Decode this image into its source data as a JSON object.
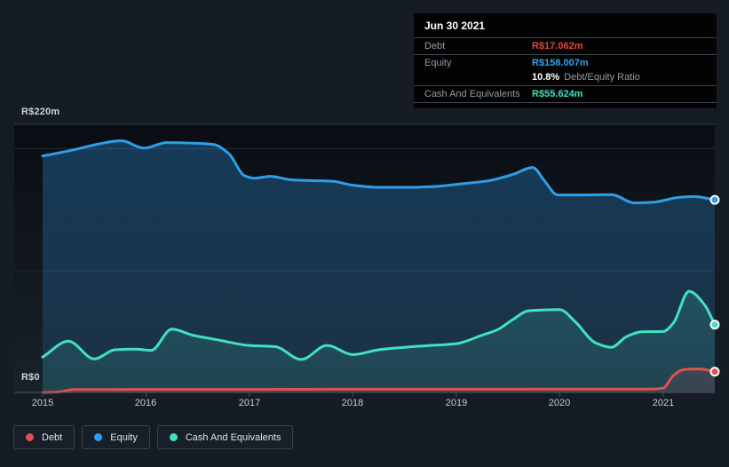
{
  "page": {
    "background": "#161c26"
  },
  "tooltip": {
    "date": "Jun 30 2021",
    "debt_label": "Debt",
    "debt_value": "R$17.062m",
    "debt_color": "#e8423e",
    "equity_label": "Equity",
    "equity_value": "R$158.007m",
    "equity_color": "#2ea4ee",
    "ratio_value": "10.8%",
    "ratio_label": "Debt/Equity Ratio",
    "cash_label": "Cash And Equivalents",
    "cash_value": "R$55.624m",
    "cash_color": "#3ce2ba"
  },
  "legend": {
    "items": [
      {
        "label": "Debt",
        "color": "#e0514e"
      },
      {
        "label": "Equity",
        "color": "#2d9fe8"
      },
      {
        "label": "Cash And Equivalents",
        "color": "#41e1bf"
      }
    ]
  },
  "chart_data": {
    "type": "area",
    "title": "Debt to Equity history",
    "currency_prefix": "R$",
    "unit_suffix": "m",
    "x_domain": [
      2015,
      2021.5
    ],
    "y_domain": [
      0,
      220
    ],
    "y_axis_labels": [
      {
        "value": 220,
        "label": "R$220m"
      },
      {
        "value": 0,
        "label": "R$0"
      }
    ],
    "x_ticks": [
      "2015",
      "2016",
      "2017",
      "2018",
      "2019",
      "2020",
      "2021"
    ],
    "x_tick_values": [
      2015,
      2016,
      2017,
      2018,
      2019,
      2020,
      2021
    ],
    "gridlines": [
      {
        "value": 220,
        "strong": true
      },
      {
        "value": 200,
        "strong": false
      },
      {
        "value": 100,
        "strong": false
      }
    ],
    "legend_position": "bottom-left",
    "series": [
      {
        "name": "Debt",
        "z": 3,
        "color": "#e0514e",
        "fill_top": "rgba(224,81,78,0.30)",
        "fill_bottom": "rgba(224,81,78,0.12)",
        "last_value": 17.062,
        "points": [
          [
            2015.0,
            0
          ],
          [
            2015.15,
            0.4
          ],
          [
            2015.3,
            2.3
          ],
          [
            2016.0,
            2.5
          ],
          [
            2017.0,
            2.5
          ],
          [
            2018.0,
            2.6
          ],
          [
            2019.0,
            2.6
          ],
          [
            2020.0,
            2.7
          ],
          [
            2020.9,
            2.8
          ],
          [
            2021.0,
            3.5
          ],
          [
            2021.1,
            14
          ],
          [
            2021.2,
            18.8
          ],
          [
            2021.35,
            19.2
          ],
          [
            2021.5,
            17.062
          ]
        ]
      },
      {
        "name": "Equity",
        "z": 1,
        "color": "#2d9fe8",
        "fill_top": "rgba(45,150,226,0.34)",
        "fill_bottom": "rgba(45,150,226,0.14)",
        "last_value": 158.007,
        "points": [
          [
            2015.0,
            194
          ],
          [
            2015.3,
            199
          ],
          [
            2015.55,
            204
          ],
          [
            2015.76,
            206.5
          ],
          [
            2015.98,
            200.5
          ],
          [
            2016.2,
            205
          ],
          [
            2016.45,
            204.5
          ],
          [
            2016.65,
            203.5
          ],
          [
            2016.8,
            196
          ],
          [
            2016.95,
            178
          ],
          [
            2017.05,
            175.8
          ],
          [
            2017.2,
            177.3
          ],
          [
            2017.4,
            174.5
          ],
          [
            2017.6,
            173.8
          ],
          [
            2017.8,
            173.3
          ],
          [
            2018.0,
            170
          ],
          [
            2018.25,
            168.3
          ],
          [
            2018.55,
            168.3
          ],
          [
            2018.8,
            169
          ],
          [
            2019.05,
            171.2
          ],
          [
            2019.3,
            173.5
          ],
          [
            2019.55,
            179
          ],
          [
            2019.74,
            184.6
          ],
          [
            2019.85,
            174
          ],
          [
            2019.98,
            162
          ],
          [
            2020.2,
            162
          ],
          [
            2020.5,
            162.3
          ],
          [
            2020.72,
            155.5
          ],
          [
            2020.9,
            156
          ],
          [
            2021.15,
            160
          ],
          [
            2021.3,
            160.7
          ],
          [
            2021.5,
            158.007
          ]
        ]
      },
      {
        "name": "Cash And Equivalents",
        "z": 2,
        "color": "#41e1bf",
        "fill_top": "rgba(72,224,193,0.28)",
        "fill_bottom": "rgba(72,224,193,0.10)",
        "last_value": 55.624,
        "points": [
          [
            2015.0,
            29
          ],
          [
            2015.25,
            42
          ],
          [
            2015.5,
            27.5
          ],
          [
            2015.7,
            35
          ],
          [
            2015.9,
            35.5
          ],
          [
            2016.05,
            34.5
          ],
          [
            2016.25,
            52
          ],
          [
            2016.45,
            47
          ],
          [
            2016.7,
            43
          ],
          [
            2017.0,
            38.5
          ],
          [
            2017.25,
            37.5
          ],
          [
            2017.5,
            27
          ],
          [
            2017.75,
            38.5
          ],
          [
            2018.0,
            31
          ],
          [
            2018.25,
            35
          ],
          [
            2018.5,
            37
          ],
          [
            2018.75,
            38.5
          ],
          [
            2019.0,
            40
          ],
          [
            2019.25,
            47
          ],
          [
            2019.4,
            51.5
          ],
          [
            2019.55,
            60
          ],
          [
            2019.7,
            67
          ],
          [
            2020.0,
            68
          ],
          [
            2020.15,
            58
          ],
          [
            2020.35,
            40.5
          ],
          [
            2020.5,
            37
          ],
          [
            2020.65,
            46
          ],
          [
            2020.8,
            49.8
          ],
          [
            2021.0,
            50
          ],
          [
            2021.1,
            57
          ],
          [
            2021.25,
            83
          ],
          [
            2021.4,
            72
          ],
          [
            2021.5,
            55.624
          ]
        ]
      }
    ]
  }
}
